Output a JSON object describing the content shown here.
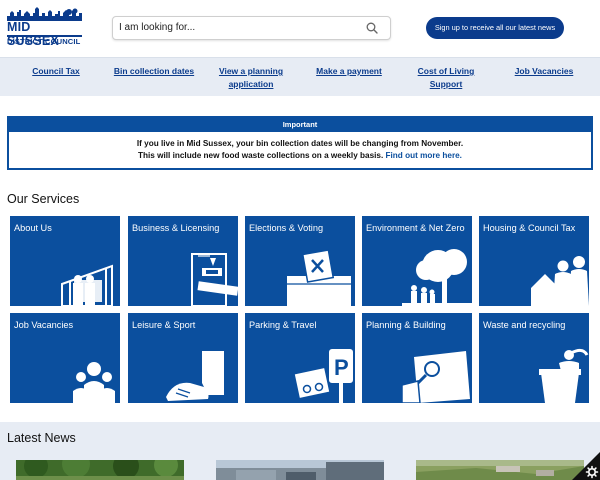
{
  "header": {
    "logo_line1": "MID SUSSEX",
    "logo_line2": "DISTRICT COUNCIL",
    "search_placeholder": "I am looking for...",
    "signup_label": "Sign up to receive all our latest news"
  },
  "nav": {
    "items": [
      {
        "label": "Council Tax"
      },
      {
        "label": "Bin collection dates"
      },
      {
        "label": "View a planning application"
      },
      {
        "label": "Make a payment"
      },
      {
        "label": "Cost of Living Support"
      },
      {
        "label": "Job Vacancies"
      }
    ]
  },
  "notice": {
    "heading": "Important",
    "line1": "If you live in Mid Sussex, your bin collection dates will be changing from November.",
    "line2": "This will include new food waste collections on a weekly basis.",
    "link": "Find out more here."
  },
  "services": {
    "title": "Our Services",
    "tiles": [
      {
        "label": "About Us"
      },
      {
        "label": "Business & Licensing"
      },
      {
        "label": "Elections & Voting"
      },
      {
        "label": "Environment & Net Zero"
      },
      {
        "label": "Housing & Council Tax"
      },
      {
        "label": "Job Vacancies"
      },
      {
        "label": "Leisure & Sport"
      },
      {
        "label": "Parking & Travel"
      },
      {
        "label": "Planning & Building"
      },
      {
        "label": "Waste and recycling"
      }
    ]
  },
  "news": {
    "title": "Latest News"
  },
  "colors": {
    "brand": "#0b3b8c",
    "tile": "#0b4f9e",
    "nav_bg": "#e7ecf4"
  }
}
